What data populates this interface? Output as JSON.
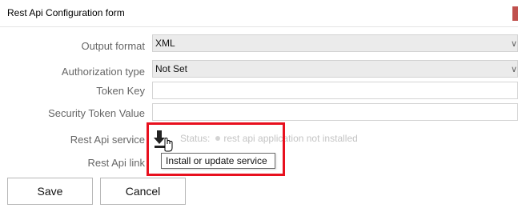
{
  "window": {
    "title": "Rest Api Configuration form",
    "accent_color": "#c0504d"
  },
  "form": {
    "output_format": {
      "label": "Output format",
      "value": "XML"
    },
    "authorization_type": {
      "label": "Authorization type",
      "value": "Not Set"
    },
    "token_key": {
      "label": "Token Key",
      "value": ""
    },
    "security_token_value": {
      "label": "Security Token Value",
      "value": ""
    },
    "rest_api_service": {
      "label": "Rest Api service",
      "icon": "download-install-icon",
      "status_label": "Status:",
      "status_text": "rest api application not installed",
      "tooltip": "Install or update service"
    },
    "rest_api_link": {
      "label": "Rest Api link"
    }
  },
  "buttons": {
    "save": "Save",
    "cancel": "Cancel"
  },
  "highlight_color": "#e8101e"
}
